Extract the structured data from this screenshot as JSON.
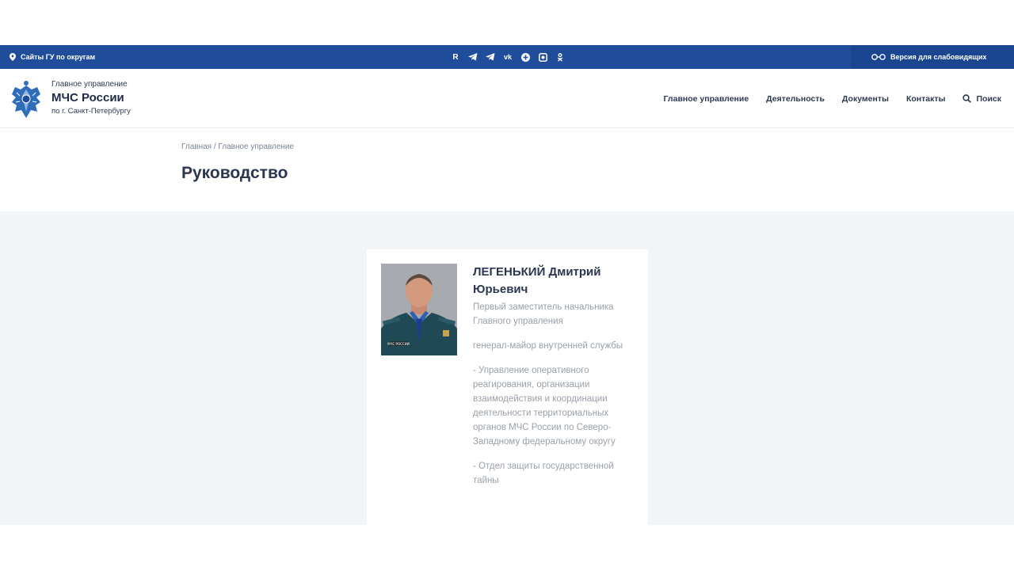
{
  "topbar": {
    "regions_label": "Сайты ГУ по округам",
    "social_icons": [
      "rutube-icon",
      "telegram-icon",
      "telegram-icon-2",
      "vk-icon",
      "plus-icon",
      "instagram-icon",
      "odnoklassniki-icon"
    ],
    "vision_label": "Версия для слабовидящих",
    "colors": {
      "bar": "#1f4d9b",
      "vision_bg": "#1a4590"
    }
  },
  "header": {
    "brand_line1": "Главное управление",
    "brand_line2": "МЧС России",
    "brand_line3": "по г. Санкт-Петербургу",
    "nav": {
      "main": "Главное управление",
      "activity": "Деятельность",
      "documents": "Документы",
      "contacts": "Контакты",
      "search": "Поиск"
    }
  },
  "breadcrumb": {
    "home": "Главная",
    "separator": " / ",
    "section": "Главное управление"
  },
  "page": {
    "title": "Руководство"
  },
  "person": {
    "name_line1": "ЛЕГЕНЬКИЙ Дмитрий",
    "name_line2": "Юрьевич",
    "position": "Первый заместитель начальника Главного управления",
    "rank": "генерал-майор внутренней службы",
    "dept1": "- Управление оперативного реагирования, организации взаимодействия и координации деятельности территориальных органов МЧС России по Северо-Западному федеральному округу",
    "dept2": "- Отдел защиты государственной тайны",
    "photo_badge": "МЧС РОССИИ"
  }
}
